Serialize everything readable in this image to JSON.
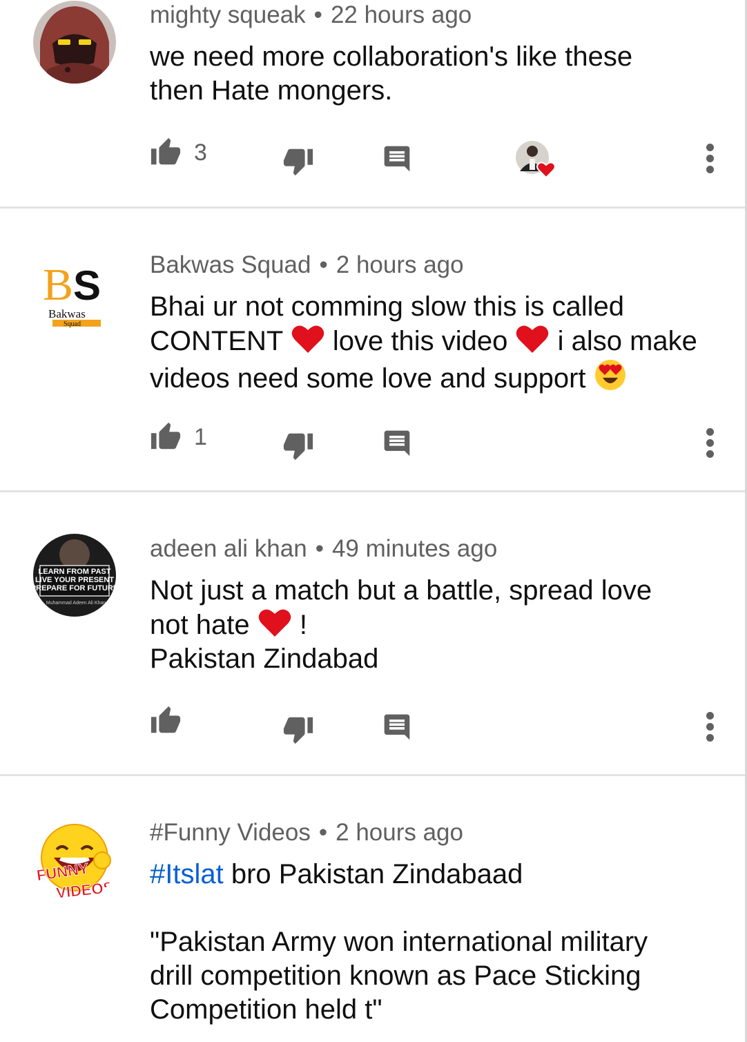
{
  "comments": [
    {
      "author": "mighty squeak",
      "time": "22 hours ago",
      "lines": [
        "we need more collaboration's like these",
        "then Hate mongers."
      ],
      "likes": "3",
      "creator_hearted": true
    },
    {
      "author": "Bakwas Squad",
      "time": "2 hours ago",
      "line1": "Bhai ur not comming slow this is called",
      "line2_a": "CONTENT",
      "line2_b": "love this video",
      "line2_c": "i also make",
      "line3_a": "videos need some love and support",
      "likes": "1",
      "avatar_text": [
        "B",
        "S",
        "Bakwas",
        "Squad"
      ]
    },
    {
      "author": "adeen ali khan",
      "time": "49 minutes ago",
      "line1": "Not just a match but a battle, spread love",
      "line2_a": "not hate",
      "line2_b": "!",
      "line3": "Pakistan Zindabad",
      "likes": "",
      "avatar_text": [
        "LEARN FROM PAST",
        "LIVE YOUR PRESENT",
        "PREPARE FOR FUTURE",
        "Muhammad Adeen Ali Khan"
      ]
    },
    {
      "author": "#Funny Videos",
      "time": "2 hours ago",
      "hashtag": "#Itslat",
      "line1_rest": " bro Pakistan Zindabaad",
      "line2": "\"Pakistan Army won international military",
      "line3": "drill competition known as Pace Sticking",
      "line4": "Competition held t\"",
      "avatar_text": [
        "FUNNY",
        "VIDEOS"
      ]
    }
  ],
  "meta_separator": "•",
  "colors": {
    "hashtag": "#065fd4",
    "meta": "#606060",
    "text": "#0f0f0f",
    "heart": "#e0101c",
    "divider": "#e3e3e3"
  },
  "icons": [
    "thumbs-up-icon",
    "thumbs-down-icon",
    "reply-icon",
    "more-vert-icon",
    "red-heart-emoji",
    "heart-eyes-emoji"
  ]
}
